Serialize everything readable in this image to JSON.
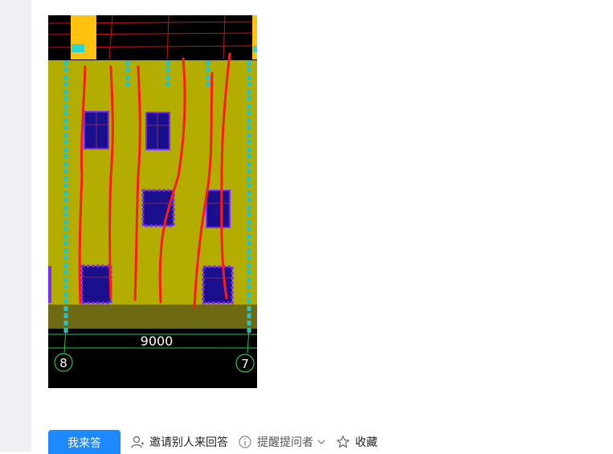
{
  "drawing": {
    "dimension_label": "9000",
    "axis_left": "8",
    "axis_right": "7"
  },
  "actions": {
    "answer_label": "我来答",
    "invite_label": "邀请别人来回答",
    "remind_label": "提醒提问者",
    "favorite_label": "收藏"
  },
  "colors": {
    "accent": "#1e88ff",
    "wall": "#b3ad00",
    "window": "#1a0f8c",
    "crack": "#ff1a1a",
    "grid_column": "#27c4c4"
  }
}
